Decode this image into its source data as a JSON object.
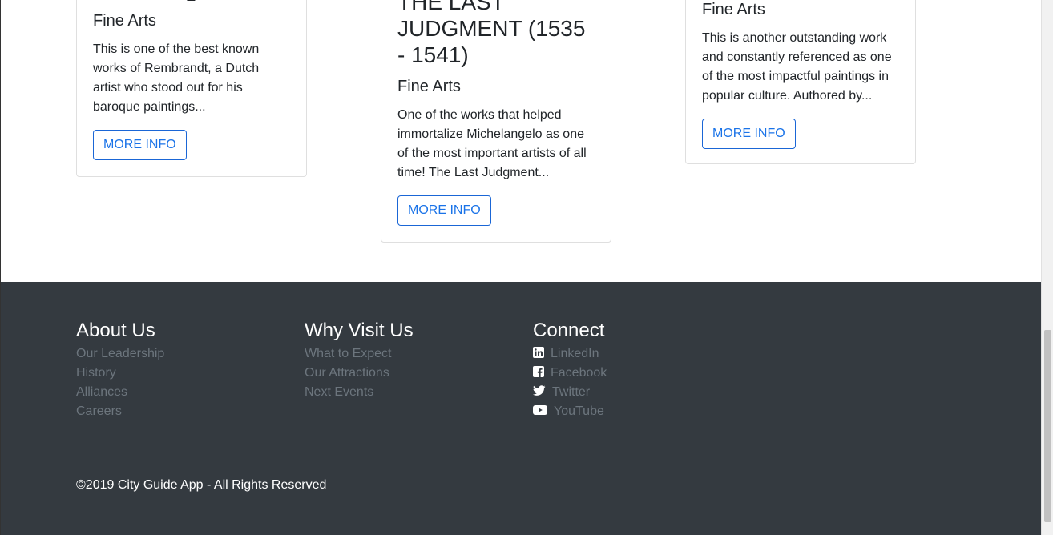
{
  "cards": [
    {
      "title_partial": "",
      "category": "Fine Arts",
      "description": "This is one of the best known works of Rembrandt, a Dutch artist who stood out for his baroque paintings...",
      "button_label": "MORE INFO"
    },
    {
      "title": "THE LAST JUDGMENT (1535 - 1541)",
      "category": "Fine Arts",
      "description": "One of the works that helped immortalize Michelangelo as one of the most important artists of all time! The Last Judgment...",
      "button_label": "MORE INFO"
    },
    {
      "category": "Fine Arts",
      "description": "This is another outstanding work and constantly referenced as one of the most impactful paintings in popular culture. Authored by...",
      "button_label": "MORE INFO"
    }
  ],
  "footer": {
    "about": {
      "heading": "About Us",
      "links": [
        "Our Leadership",
        "History",
        "Alliances",
        "Careers"
      ]
    },
    "why": {
      "heading": "Why Visit Us",
      "links": [
        "What to Expect",
        "Our Attractions",
        "Next Events"
      ]
    },
    "connect": {
      "heading": "Connect",
      "links": [
        {
          "icon": "linkedin-icon",
          "label": "LinkedIn"
        },
        {
          "icon": "facebook-icon",
          "label": "Facebook"
        },
        {
          "icon": "twitter-icon",
          "label": "Twitter"
        },
        {
          "icon": "youtube-icon",
          "label": "YouTube"
        }
      ]
    },
    "copyright": "©2019 City Guide App - All Rights Reserved"
  },
  "colors": {
    "footer_bg": "#343a40",
    "link_muted": "#6c757d",
    "button_accent": "#1a73e8"
  }
}
